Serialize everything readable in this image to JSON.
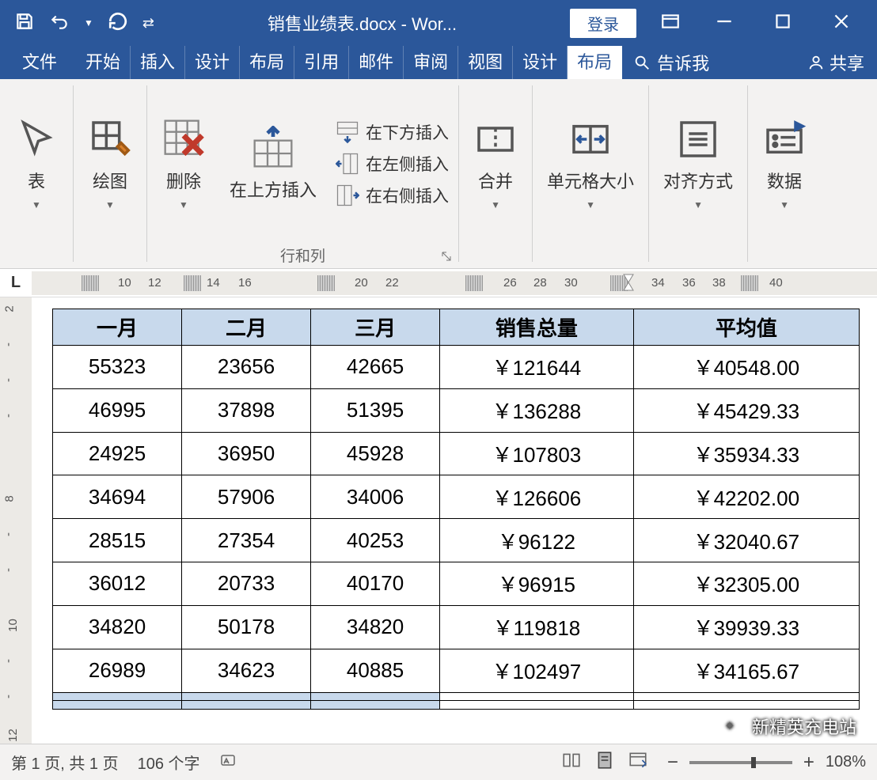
{
  "titlebar": {
    "filename": "销售业绩表.docx",
    "appname": "Wor...",
    "login": "登录"
  },
  "tabs": {
    "file": "文件",
    "home": "开始",
    "insert": "插入",
    "design": "设计",
    "layout": "布局",
    "references": "引用",
    "mail": "邮件",
    "review": "审阅",
    "view": "视图",
    "tbl_design": "设计",
    "tbl_layout": "布局",
    "tell_me": "告诉我",
    "share": "共享"
  },
  "ribbon": {
    "table": "表",
    "draw": "绘图",
    "delete": "删除",
    "insert_above": "在上方插入",
    "insert_below": "在下方插入",
    "insert_left": "在左侧插入",
    "insert_right": "在右侧插入",
    "rows_cols": "行和列",
    "merge": "合并",
    "cell_size": "单元格大小",
    "align": "对齐方式",
    "data": "数据"
  },
  "ruler": {
    "nums": [
      10,
      12,
      14,
      16,
      20,
      22,
      26,
      28,
      30,
      34,
      36,
      38,
      40
    ],
    "pos": [
      109,
      147,
      221,
      261,
      408,
      447,
      596,
      634,
      673,
      783,
      822,
      860,
      932
    ]
  },
  "vruler": {
    "nums": [
      "2",
      "-",
      "-",
      "-",
      "8",
      "-",
      "-",
      "10",
      "-",
      "-",
      "12"
    ],
    "pos": [
      6,
      51,
      96,
      141,
      246,
      291,
      336,
      406,
      451,
      496,
      545
    ]
  },
  "table_data": {
    "headers": [
      "一月",
      "二月",
      "三月",
      "销售总量",
      "平均值"
    ],
    "rows": [
      [
        "55323",
        "23656",
        "42665",
        "￥121644",
        "￥40548.00"
      ],
      [
        "46995",
        "37898",
        "51395",
        "￥136288",
        "￥45429.33"
      ],
      [
        "24925",
        "36950",
        "45928",
        "￥107803",
        "￥35934.33"
      ],
      [
        "34694",
        "57906",
        "34006",
        "￥126606",
        "￥42202.00"
      ],
      [
        "28515",
        "27354",
        "40253",
        "￥96122",
        "￥32040.67"
      ],
      [
        "36012",
        "20733",
        "40170",
        "￥96915",
        "￥32305.00"
      ],
      [
        "34820",
        "50178",
        "34820",
        "￥119818",
        "￥39939.33"
      ],
      [
        "26989",
        "34623",
        "40885",
        "￥102497",
        "￥34165.67"
      ]
    ]
  },
  "statusbar": {
    "page": "第 1 页, 共 1 页",
    "words": "106 个字",
    "zoom": "108%"
  },
  "watermark": "新精英充电站"
}
